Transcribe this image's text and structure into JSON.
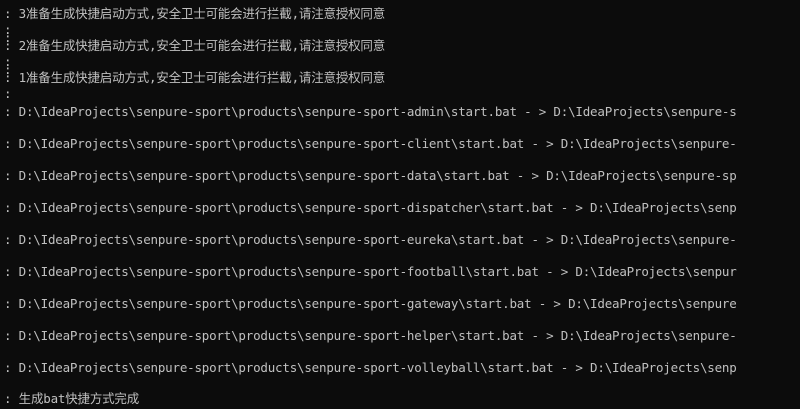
{
  "console": {
    "prompt_prefix": ":",
    "lines": [
      {
        "text": " 3准备生成快捷启动方式,安全卫士可能会进行拦截,请注意授权同意"
      },
      {
        "text": ""
      },
      {
        "text": ""
      },
      {
        "text": " 2准备生成快捷启动方式,安全卫士可能会进行拦截,请注意授权同意"
      },
      {
        "text": ""
      },
      {
        "text": ""
      },
      {
        "text": " 1准备生成快捷启动方式,安全卫士可能会进行拦截,请注意授权同意"
      },
      {
        "text": ""
      },
      {
        "text": " D:\\IdeaProjects\\senpure-sport\\products\\senpure-sport-admin\\start.bat - > D:\\IdeaProjects\\senpure-s"
      },
      {
        "text": " D:\\IdeaProjects\\senpure-sport\\products\\senpure-sport-client\\start.bat - > D:\\IdeaProjects\\senpure-"
      },
      {
        "text": " D:\\IdeaProjects\\senpure-sport\\products\\senpure-sport-data\\start.bat - > D:\\IdeaProjects\\senpure-sp"
      },
      {
        "text": " D:\\IdeaProjects\\senpure-sport\\products\\senpure-sport-dispatcher\\start.bat - > D:\\IdeaProjects\\senp"
      },
      {
        "text": " D:\\IdeaProjects\\senpure-sport\\products\\senpure-sport-eureka\\start.bat - > D:\\IdeaProjects\\senpure-"
      },
      {
        "text": " D:\\IdeaProjects\\senpure-sport\\products\\senpure-sport-football\\start.bat - > D:\\IdeaProjects\\senpur"
      },
      {
        "text": " D:\\IdeaProjects\\senpure-sport\\products\\senpure-sport-gateway\\start.bat - > D:\\IdeaProjects\\senpure"
      },
      {
        "text": " D:\\IdeaProjects\\senpure-sport\\products\\senpure-sport-helper\\start.bat - > D:\\IdeaProjects\\senpure-"
      },
      {
        "text": " D:\\IdeaProjects\\senpure-sport\\products\\senpure-sport-volleyball\\start.bat - > D:\\IdeaProjects\\senp"
      },
      {
        "text": " 生成bat快捷方式完成"
      }
    ]
  }
}
